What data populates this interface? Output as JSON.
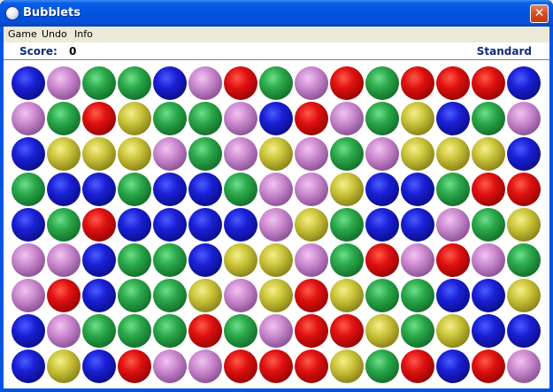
{
  "window": {
    "title": "Bubblets",
    "close_symbol": "✕"
  },
  "menu": {
    "items": [
      "Game",
      "Undo",
      "Info"
    ]
  },
  "status": {
    "score_label": "Score:",
    "score_value": "0",
    "mode": "Standard"
  },
  "colors": {
    "blue": "#1a1fd6",
    "red": "#e01010",
    "green": "#2aa84a",
    "yellow": "#cbc43a",
    "pink": "#cc8ad0"
  },
  "board": {
    "rows": 9,
    "cols": 15,
    "grid": [
      [
        "blue",
        "pink",
        "green",
        "green",
        "blue",
        "pink",
        "red",
        "green",
        "pink",
        "red",
        "green",
        "red",
        "red",
        "red",
        "blue"
      ],
      [
        "pink",
        "green",
        "red",
        "yellow",
        "green",
        "green",
        "pink",
        "blue",
        "red",
        "pink",
        "green",
        "yellow",
        "blue",
        "green",
        "pink"
      ],
      [
        "blue",
        "yellow",
        "yellow",
        "yellow",
        "pink",
        "green",
        "pink",
        "yellow",
        "pink",
        "green",
        "pink",
        "yellow",
        "yellow",
        "yellow",
        "blue"
      ],
      [
        "green",
        "blue",
        "blue",
        "green",
        "blue",
        "blue",
        "green",
        "pink",
        "pink",
        "yellow",
        "blue",
        "blue",
        "green",
        "red",
        "red"
      ],
      [
        "blue",
        "green",
        "red",
        "blue",
        "blue",
        "blue",
        "blue",
        "pink",
        "yellow",
        "green",
        "blue",
        "blue",
        "pink",
        "green",
        "yellow"
      ],
      [
        "pink",
        "pink",
        "blue",
        "green",
        "green",
        "blue",
        "yellow",
        "yellow",
        "pink",
        "green",
        "red",
        "pink",
        "red",
        "pink",
        "green"
      ],
      [
        "pink",
        "red",
        "blue",
        "green",
        "green",
        "yellow",
        "pink",
        "yellow",
        "red",
        "yellow",
        "green",
        "green",
        "blue",
        "blue",
        "yellow"
      ],
      [
        "blue",
        "pink",
        "green",
        "green",
        "green",
        "red",
        "green",
        "pink",
        "red",
        "red",
        "yellow",
        "green",
        "yellow",
        "blue",
        "blue"
      ],
      [
        "blue",
        "yellow",
        "blue",
        "red",
        "pink",
        "pink",
        "red",
        "red",
        "red",
        "yellow",
        "green",
        "red",
        "blue",
        "red",
        "pink"
      ]
    ]
  }
}
